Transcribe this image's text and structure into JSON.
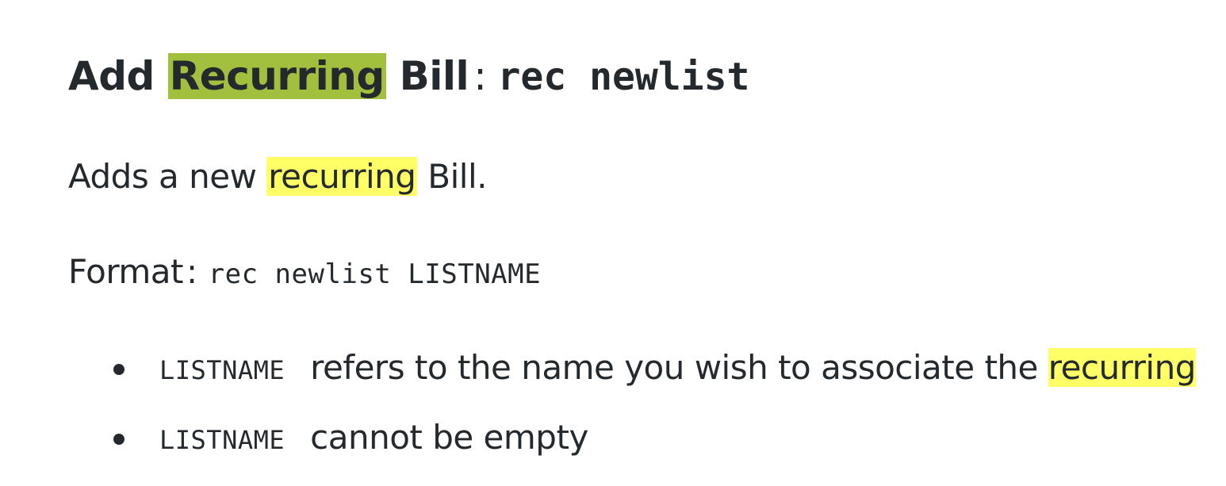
{
  "heading": {
    "prefix": "Add ",
    "highlight": "Recurring",
    "suffix": " Bill",
    "colon": ":",
    "command": "rec newlist"
  },
  "description": {
    "prefix": "Adds a new ",
    "highlight": "recurring",
    "suffix": " Bill."
  },
  "format": {
    "label": "Format",
    "colon": ":",
    "command": "rec newlist LISTNAME"
  },
  "bullets": [
    {
      "code": "LISTNAME",
      "text": "refers to the name you wish to associate the ",
      "highlight": "recurring"
    },
    {
      "code": "LISTNAME",
      "text": "cannot be empty"
    }
  ],
  "colors": {
    "text": "#24292e",
    "search_highlight_active": "#a2c03e",
    "search_highlight": "#ffff66"
  }
}
